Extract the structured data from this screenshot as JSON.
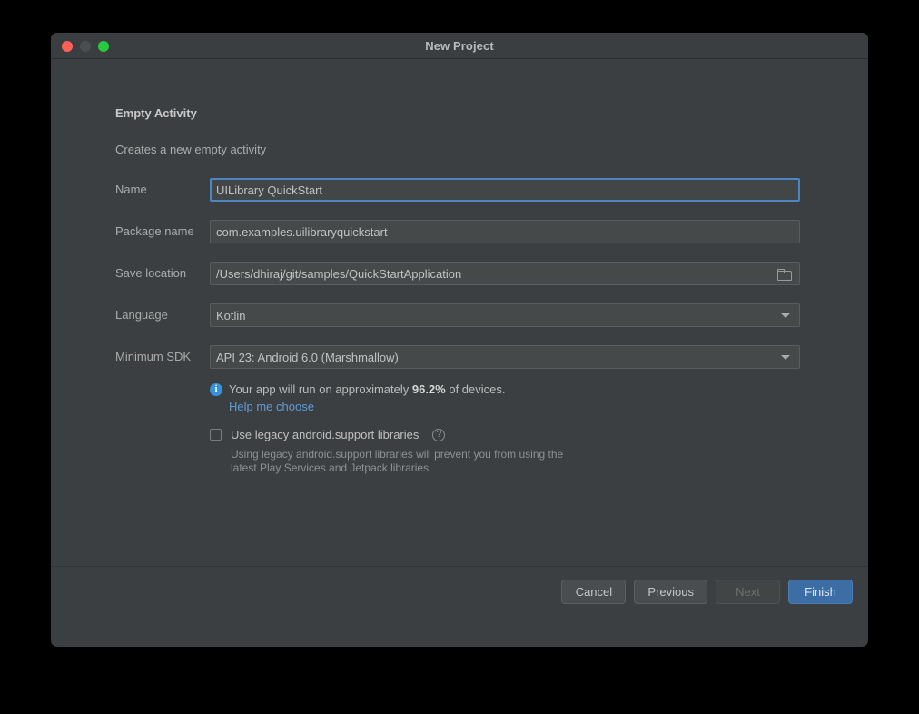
{
  "window": {
    "title": "New Project",
    "traffic_lights": [
      {
        "name": "close",
        "color": "#FF5F57"
      },
      {
        "name": "minimize",
        "color": "#4B4E50"
      },
      {
        "name": "maximize",
        "color": "#28C840"
      }
    ]
  },
  "template": {
    "title": "Empty Activity",
    "description": "Creates a new empty activity"
  },
  "form": {
    "rows": [
      {
        "label": "Name",
        "value": "UILibrary QuickStart",
        "type": "text",
        "focused": true
      },
      {
        "label": "Package name",
        "value": "com.examples.uilibraryquickstart",
        "type": "text",
        "focused": false
      },
      {
        "label": "Save location",
        "value": "/Users/dhiraj/git/samples/QuickStartApplication",
        "type": "path",
        "focused": false
      },
      {
        "label": "Language",
        "value": "Kotlin",
        "type": "dropdown",
        "focused": false
      },
      {
        "label": "Minimum SDK",
        "value": "API 23: Android 6.0 (Marshmallow)",
        "type": "dropdown",
        "focused": false
      }
    ]
  },
  "info": {
    "text_before": "Your app will run on approximately ",
    "percent": "96.2%",
    "text_after": " of devices.",
    "link": "Help me choose",
    "icon_color": "#3592D8",
    "link_color": "#5C9CD6"
  },
  "legacy": {
    "checkbox_label": "Use legacy android.support libraries",
    "checked": false,
    "help_glyph": "?",
    "description": "Using legacy android.support libraries will prevent you from using the latest Play Services and Jetpack libraries"
  },
  "footer": {
    "buttons": [
      {
        "label": "Cancel",
        "state": "normal"
      },
      {
        "label": "Previous",
        "state": "normal"
      },
      {
        "label": "Next",
        "state": "disabled"
      },
      {
        "label": "Finish",
        "state": "primary"
      }
    ]
  },
  "colors": {
    "dialog_background": "#3C3F41",
    "field_background": "#45494A",
    "focus_border": "#4C87C4",
    "primary_button": "#3C6EA5"
  }
}
